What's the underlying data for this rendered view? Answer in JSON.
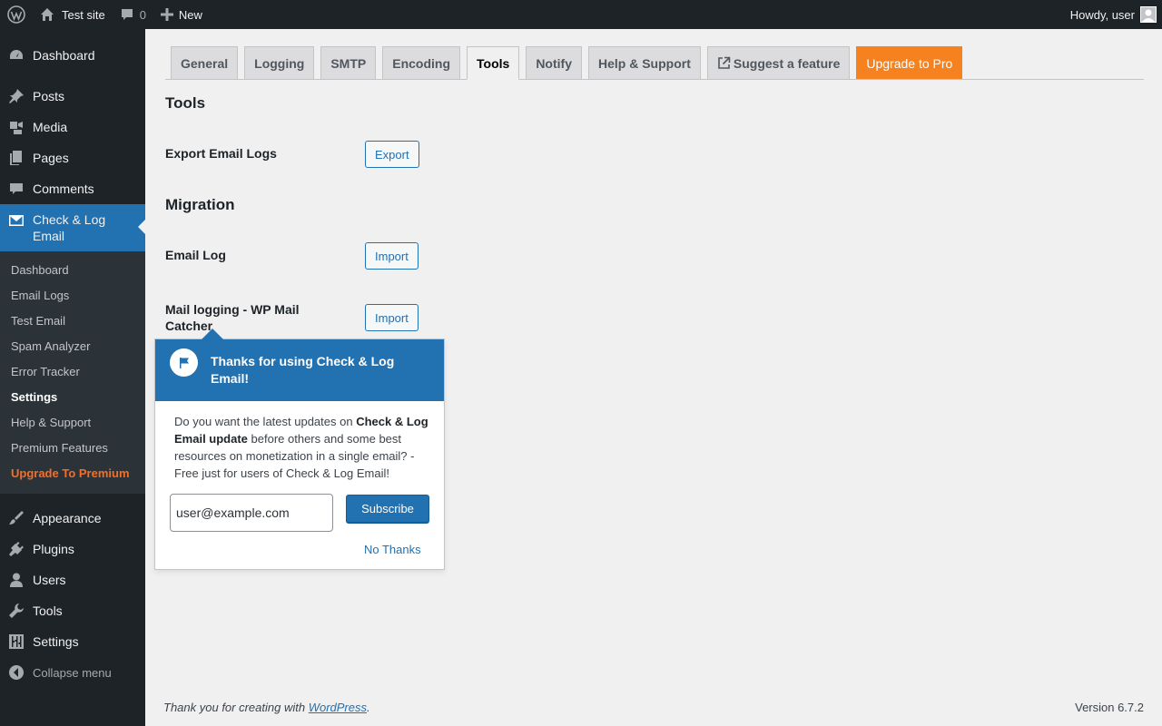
{
  "adminbar": {
    "site_name": "Test site",
    "comments_count": "0",
    "new_label": "New",
    "greeting": "Howdy, user",
    "icons": [
      "wordpress-logo-icon",
      "home-icon",
      "comment-bubble-icon",
      "plus-icon",
      "avatar-icon"
    ]
  },
  "sidebar": {
    "items": [
      {
        "label": "Dashboard",
        "icon": "dashboard-gauge-icon"
      },
      {
        "label": "Posts",
        "icon": "pushpin-icon"
      },
      {
        "label": "Media",
        "icon": "media-camera-icon"
      },
      {
        "label": "Pages",
        "icon": "pages-icon"
      },
      {
        "label": "Comments",
        "icon": "comment-bubble-icon"
      },
      {
        "label": "Check & Log Email",
        "icon": "envelope-icon"
      },
      {
        "label": "Appearance",
        "icon": "paintbrush-icon"
      },
      {
        "label": "Plugins",
        "icon": "plug-icon"
      },
      {
        "label": "Users",
        "icon": "user-icon"
      },
      {
        "label": "Tools",
        "icon": "wrench-icon"
      },
      {
        "label": "Settings",
        "icon": "sliders-icon"
      }
    ],
    "submenu": [
      "Dashboard",
      "Email Logs",
      "Test Email",
      "Spam Analyzer",
      "Error Tracker",
      "Settings",
      "Help & Support",
      "Premium Features",
      "Upgrade To Premium"
    ],
    "collapse_label": "Collapse menu",
    "accent_color": "#2271b1",
    "premium_color": "#f56e28"
  },
  "tabs": [
    "General",
    "Logging",
    "SMTP",
    "Encoding",
    "Tools",
    "Notify",
    "Help & Support",
    "Suggest a feature",
    "Upgrade to Pro"
  ],
  "active_tab": "Tools",
  "main": {
    "tools_heading": "Tools",
    "export_label": "Export Email Logs",
    "export_button": "Export",
    "migration_heading": "Migration",
    "email_log_label": "Email Log",
    "mail_catcher_label": "Mail logging - WP Mail Catcher",
    "import_button": "Import"
  },
  "popup": {
    "title": "Thanks for using Check & Log Email!",
    "body_prefix": "Do you want the latest updates on ",
    "body_bold": "Check & Log Email update",
    "body_suffix": " before others and some best resources on monetization in a single email? - Free just for users of Check & Log Email!",
    "email_value": "user@example.com",
    "subscribe_label": "Subscribe",
    "no_thanks_label": "No Thanks",
    "icon": "flag-icon"
  },
  "footer": {
    "thanks_prefix": "Thank you for creating with ",
    "thanks_link": "WordPress",
    "thanks_suffix": ".",
    "version": "Version 6.7.2"
  }
}
